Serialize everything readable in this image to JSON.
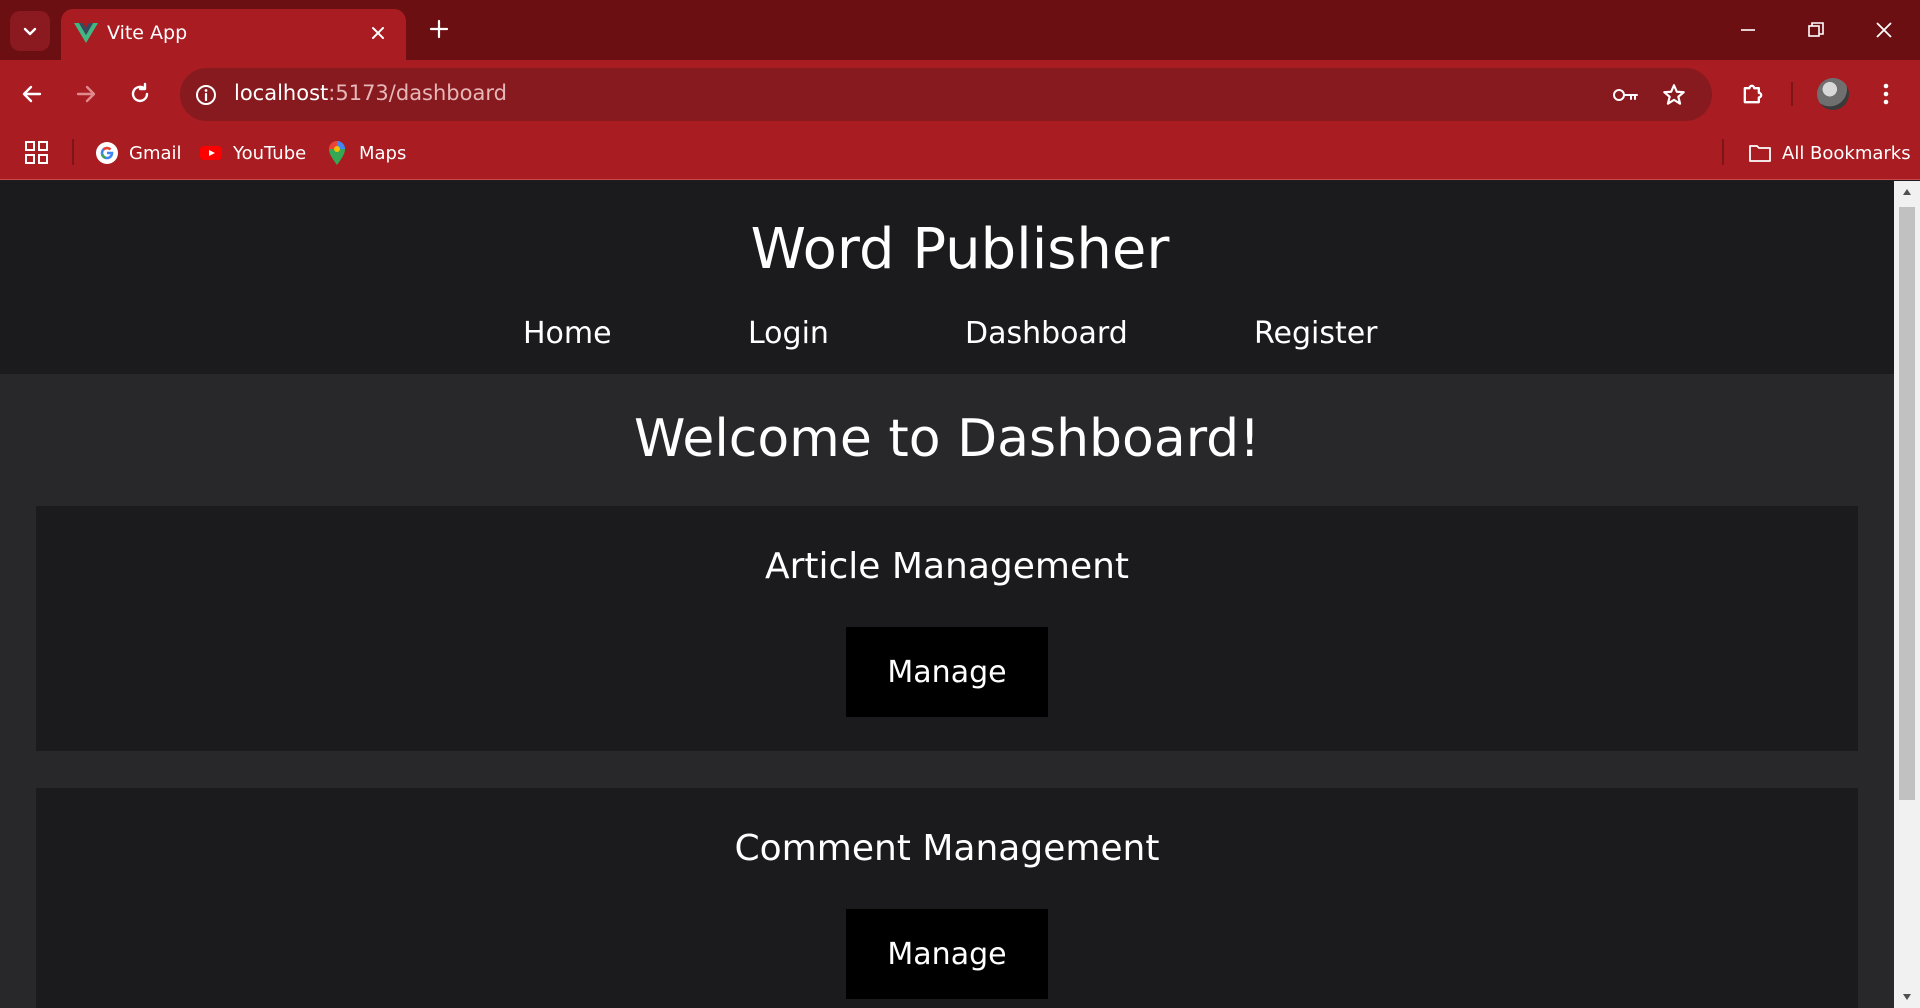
{
  "browser": {
    "tab_title": "Vite App",
    "url_host": "localhost",
    "url_path": ":5173/dashboard",
    "bookmarks": [
      {
        "label": "Gmail",
        "icon": "google-icon"
      },
      {
        "label": "YouTube",
        "icon": "youtube-icon"
      },
      {
        "label": "Maps",
        "icon": "maps-icon"
      }
    ],
    "all_bookmarks_label": "All Bookmarks",
    "colors": {
      "tabstrip": "#6b0f13",
      "toolbar": "#a81c22",
      "omnibox": "#871a1f"
    }
  },
  "site": {
    "title": "Word Publisher",
    "nav": [
      "Home",
      "Login",
      "Dashboard",
      "Register"
    ]
  },
  "main": {
    "welcome": "Welcome to Dashboard!",
    "cards": [
      {
        "title": "Article Management",
        "button": "Manage"
      },
      {
        "title": "Comment Management",
        "button": "Manage"
      }
    ]
  }
}
